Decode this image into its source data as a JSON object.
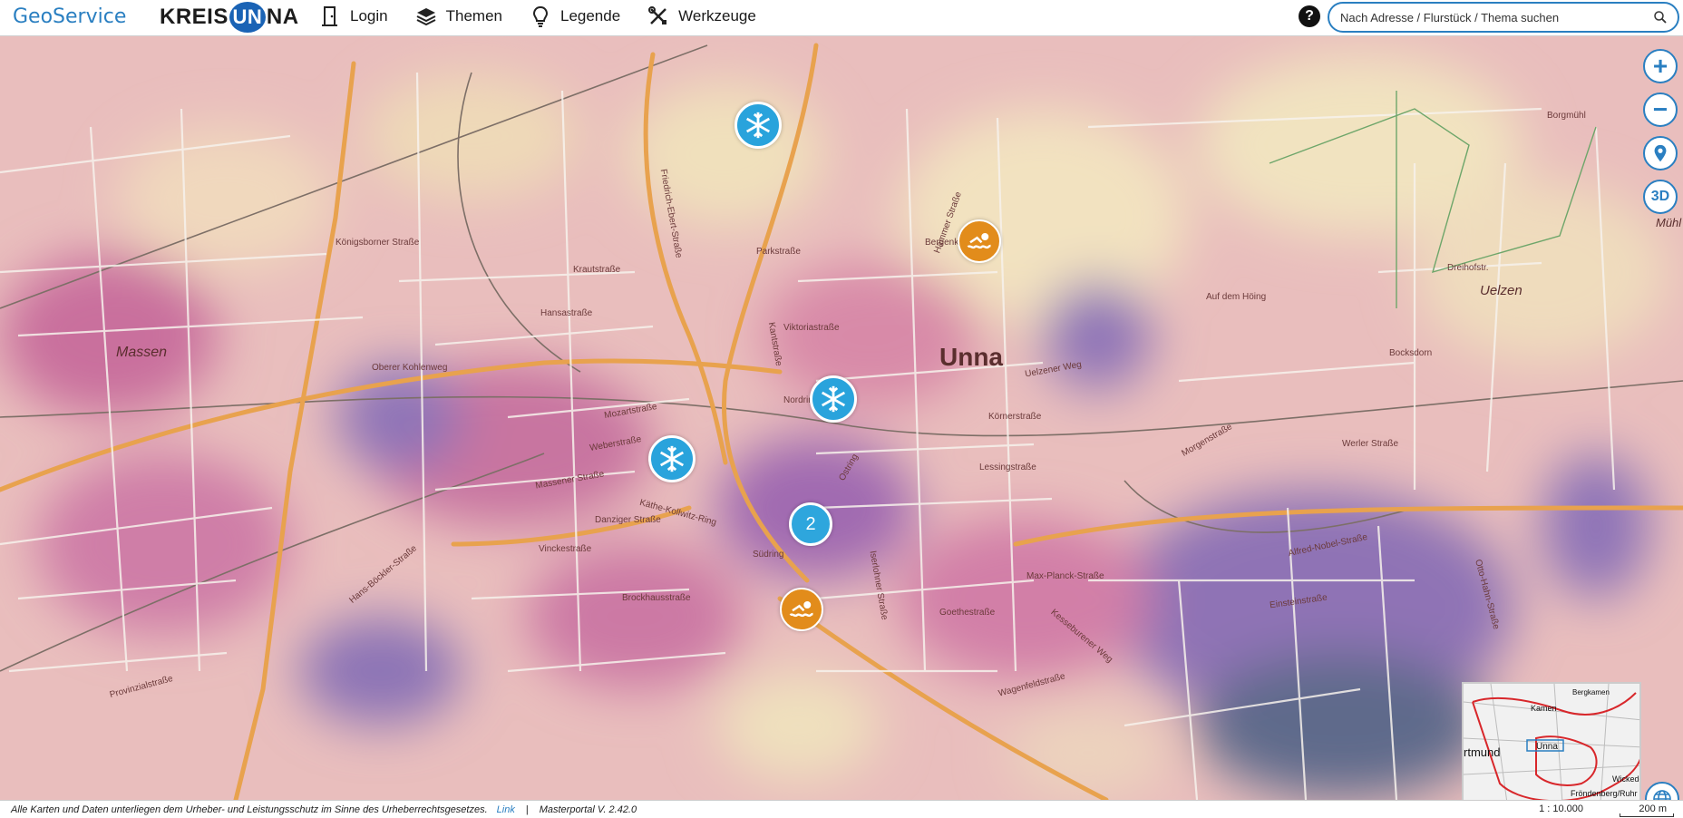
{
  "header": {
    "brand": "GeoService",
    "logo_left": "KREIS",
    "logo_circle": "UN",
    "logo_right": "NA",
    "nav": [
      {
        "label": "Login",
        "icon": "door-icon"
      },
      {
        "label": "Themen",
        "icon": "layers-icon"
      },
      {
        "label": "Legende",
        "icon": "lightbulb-icon"
      },
      {
        "label": "Werkzeuge",
        "icon": "tools-icon"
      }
    ],
    "help_label": "?",
    "search_placeholder": "Nach Adresse / Flurstück / Thema suchen"
  },
  "map": {
    "city_label": "Unna",
    "district_labels": [
      "Massen",
      "Uelzen",
      "Mühl"
    ],
    "street_labels": [
      "Hansastraße",
      "Viktoriastraße",
      "Massener Straße",
      "Werler Straße",
      "Käthe-Kollwitz-Ring",
      "Max-Planck-Straße",
      "Hammer Straße",
      "Friedrich-Ebert-Straße",
      "Kantstraße",
      "Einsteinstraße",
      "Alfred-Nobel-Straße",
      "Otto-Hahn-Straße",
      "Königsborner Straße",
      "Krautstraße",
      "Parkstraße",
      "Mozartstraße",
      "Weberstraße",
      "Vinckestraße",
      "Danziger Straße",
      "Oberer Kohlenweg",
      "Bergenkamp",
      "Auf dem Höing",
      "Uelzener Weg",
      "Kesseburener Weg",
      "Wagenfeldstraße",
      "Provinzialstraße",
      "Hans-Böckler-Straße",
      "Iserlohner Straße",
      "Südring",
      "Ostring",
      "Nordring",
      "Morgenstraße",
      "Lessingstraße",
      "Körnerstraße",
      "Goethestraße",
      "Brockhausstraße",
      "Dreihofstr.",
      "Bocksdorn",
      "Borgmühl"
    ],
    "cluster_count": "2",
    "markers": [
      {
        "type": "snowflake"
      },
      {
        "type": "snowflake"
      },
      {
        "type": "snowflake"
      },
      {
        "type": "swimming"
      },
      {
        "type": "swimming"
      }
    ],
    "controls": {
      "zoom_in": "+",
      "zoom_out": "−",
      "three_d": "3D"
    },
    "minimap_labels": [
      "Kamen",
      "rtmund",
      "Unna",
      "Fröndenberg/Ruhr",
      "Bergkamen",
      "Wickede"
    ]
  },
  "footer": {
    "copyright": "Alle Karten und Daten unterliegen dem Urheber- und Leistungsschutz im Sinne des Urheberrechtsgesetzes.",
    "link": "Link",
    "version": "Masterportal V. 2.42.0",
    "scale": "1 : 10.000",
    "distance": "200 m"
  },
  "colors": {
    "brand": "#2a7fc1",
    "snow_marker": "#29a3dc",
    "swim_marker": "#e28c1b",
    "heat_warm": "#e9b9b9",
    "heat_cool": "#7f6aa9"
  }
}
